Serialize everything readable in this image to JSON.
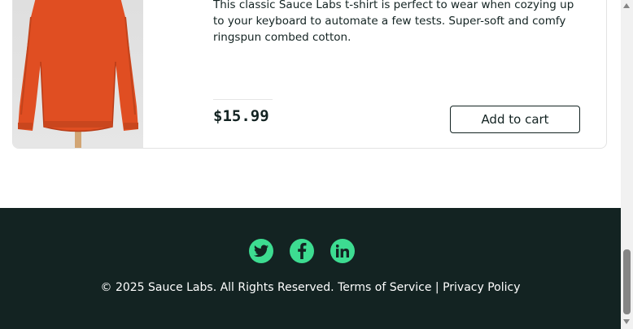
{
  "product": {
    "description": "This classic Sauce Labs t-shirt is perfect to wear when cozying up to your keyboard to automate a few tests. Super-soft and comfy ringspun combed cotton.",
    "price": "$15.99",
    "add_to_cart_label": "Add to cart",
    "image_icon": "orange-sweatshirt-image"
  },
  "footer": {
    "social": [
      {
        "name": "twitter-icon"
      },
      {
        "name": "facebook-icon"
      },
      {
        "name": "linkedin-icon"
      }
    ],
    "copyright": "© 2025 Sauce Labs. All Rights Reserved. ",
    "terms_label": "Terms of Service",
    "separator": " | ",
    "privacy_label": "Privacy Policy"
  },
  "colors": {
    "footer_bg": "#132322",
    "social_accent": "#3ddc91",
    "product_orange": "#e04e22"
  }
}
